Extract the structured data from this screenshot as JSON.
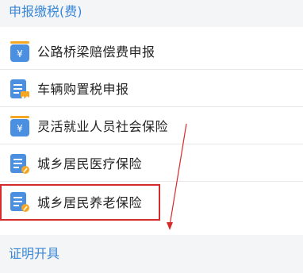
{
  "sections": {
    "declare_title": "申报缴税(费)",
    "certificate_title": "证明开具"
  },
  "menu": [
    {
      "label": "公路桥梁赔偿费申报",
      "icon": "yuan-coin-icon"
    },
    {
      "label": "车辆购置税申报",
      "icon": "document-car-icon"
    },
    {
      "label": "灵活就业人员社会保险",
      "icon": "yuan-coin-icon"
    },
    {
      "label": "城乡居民医疗保险",
      "icon": "document-pencil-icon"
    },
    {
      "label": "城乡居民养老保险",
      "icon": "document-pencil-icon"
    }
  ],
  "colors": {
    "accent": "#3a87d6",
    "icon_blue": "#4a8fe0",
    "icon_orange": "#f5a623",
    "highlight": "#d62b2b"
  }
}
